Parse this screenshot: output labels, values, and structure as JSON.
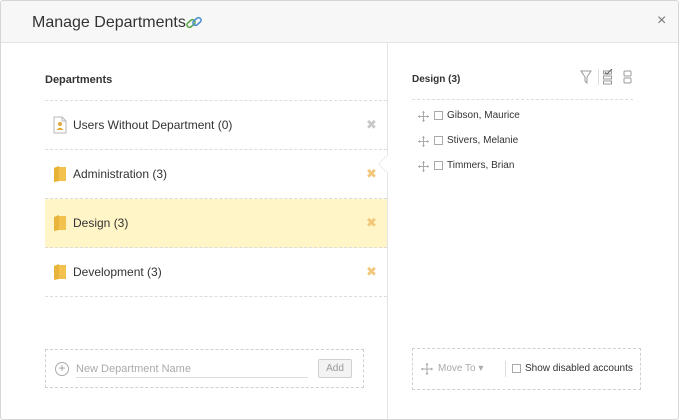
{
  "dialog": {
    "title": "Manage Departments",
    "icons": {
      "title_link": "link-icon",
      "close": "close-icon"
    },
    "close_glyph": "×"
  },
  "departments": {
    "section_title": "Departments",
    "items": [
      {
        "label": "Users Without Department (0)",
        "icon": "user-card-icon",
        "deletable": false,
        "selected": false
      },
      {
        "label": "Administration (3)",
        "icon": "folder-icon",
        "deletable": true,
        "selected": false
      },
      {
        "label": "Design (3)",
        "icon": "folder-icon",
        "deletable": true,
        "selected": true
      },
      {
        "label": "Development (3)",
        "icon": "folder-icon",
        "deletable": true,
        "selected": false
      }
    ],
    "delete_glyph": "✖",
    "new_department": {
      "placeholder": "New Department Name",
      "value": "",
      "add_label": "Add"
    }
  },
  "members": {
    "title": "Design (3)",
    "toolbar": [
      "filter-icon",
      "select-all-icon",
      "columns-icon"
    ],
    "users": [
      {
        "name": "Gibson, Maurice",
        "checked": false
      },
      {
        "name": "Stivers, Melanie",
        "checked": false
      },
      {
        "name": "Timmers, Brian",
        "checked": false
      }
    ],
    "footer": {
      "move_to_label": "Move To ▾",
      "show_disabled_label": "Show disabled accounts",
      "show_disabled_checked": false
    }
  },
  "colors": {
    "selected_row": "#fff5c6",
    "delete_active": "#f3c77a",
    "delete_disabled": "#c8c8c8",
    "folder": "#f2c14e"
  }
}
